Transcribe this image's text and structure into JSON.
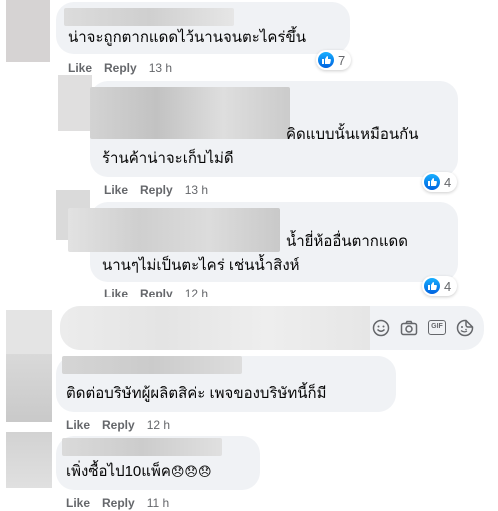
{
  "actions": {
    "like": "Like",
    "reply": "Reply"
  },
  "comments": [
    {
      "text": "น่าจะถูกตากแดดไว้นานจนตะไคร่ขึ้น",
      "time": "13 h",
      "reactions": "7"
    },
    {
      "line1": "คิดแบบนั้นเหมือนกัน",
      "line2": "ร้านค้าน่าจะเก็บไม่ดี",
      "time": "13 h",
      "reactions": "4"
    },
    {
      "line1": "น้ำยี่ห้ออื่นตากแดด",
      "line2": "นานๆไม่เป็นตะไคร่ เช่นน้ำสิงห์",
      "time": "12 h",
      "reactions": "4"
    },
    {
      "text": "ติดต่อบริษัทผู้ผลิตสิค่ะ เพจของบริษัทนี้ก็มี",
      "time": "12 h"
    },
    {
      "text": "เพิ่งซื้อไป10แพ็ค",
      "emoji": "😞😞😞",
      "time": "11 h"
    }
  ],
  "composer": {
    "icons": [
      "emoji-smile-icon",
      "camera-icon",
      "gif-icon",
      "sticker-icon"
    ],
    "gif_label": "GIF"
  },
  "colors": {
    "bubble": "#f0f2f5",
    "meta": "#65676b",
    "like_blue": "#1877f2"
  }
}
